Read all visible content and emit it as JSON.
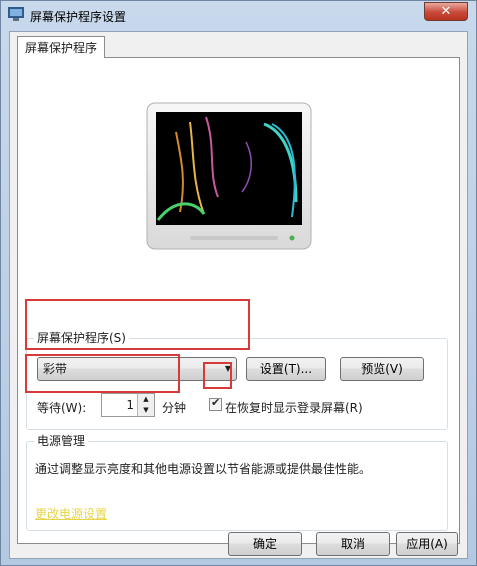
{
  "window": {
    "title": "屏幕保护程序设置",
    "close_glyph": "✕"
  },
  "tab": {
    "label": "屏幕保护程序"
  },
  "screensaver": {
    "group_label": "屏幕保护程序(S)",
    "selected": "彩带",
    "settings_button": "设置(T)...",
    "preview_button": "预览(V)",
    "wait_label": "等待(W):",
    "wait_value": "1",
    "wait_unit": "分钟",
    "resume_label": "在恢复时显示登录屏幕(R)",
    "resume_checked": true
  },
  "power": {
    "group_label": "电源管理",
    "description": "通过调整显示亮度和其他电源设置以节省能源或提供最佳性能。",
    "link": "更改电源设置"
  },
  "footer": {
    "ok_button": "确定",
    "cancel_button": "取消",
    "apply_button": "应用(A)"
  },
  "icons": [
    "app-icon",
    "close-icon",
    "dropdown-arrow-icon",
    "spin-up-icon",
    "spin-down-icon",
    "checkmark-icon"
  ],
  "colors": {
    "highlight_box": "#d83a3a",
    "link": "#e7d447"
  }
}
